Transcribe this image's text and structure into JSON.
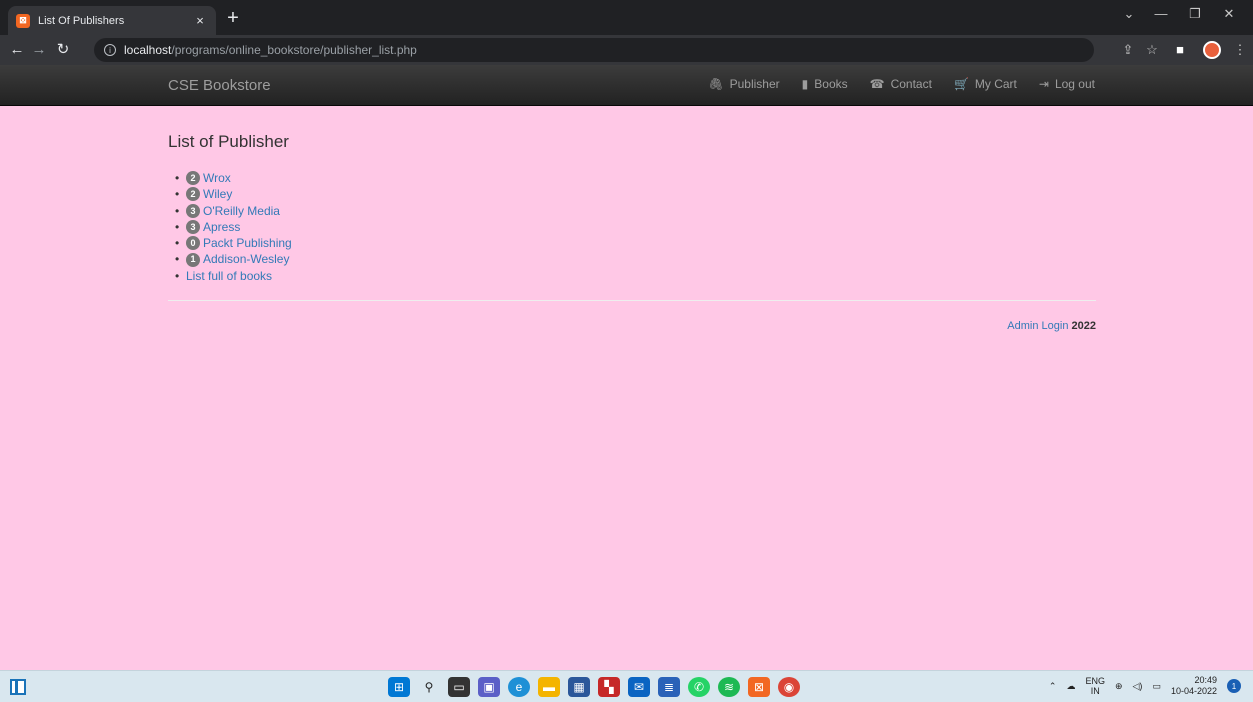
{
  "browser": {
    "tab_title": "List Of Publishers",
    "tab_close": "×",
    "new_tab": "+",
    "url_host": "localhost",
    "url_path": "/programs/online_bookstore/publisher_list.php",
    "window_controls": [
      "⌄",
      "—",
      "❐",
      "✕"
    ]
  },
  "navbar": {
    "brand": "CSE Bookstore",
    "links": [
      {
        "icon": "paperclip-icon",
        "glyph": "🖇",
        "label": "Publisher"
      },
      {
        "icon": "book-icon",
        "glyph": "▮",
        "label": "Books"
      },
      {
        "icon": "phone-icon",
        "glyph": "☎",
        "label": "Contact"
      },
      {
        "icon": "cart-icon",
        "glyph": "🛒",
        "label": "My Cart"
      },
      {
        "icon": "logout-icon",
        "glyph": "⇥",
        "label": "Log out"
      }
    ]
  },
  "main": {
    "title": "List of Publisher",
    "publishers": [
      {
        "count": "2",
        "name": "Wrox"
      },
      {
        "count": "2",
        "name": "Wiley"
      },
      {
        "count": "3",
        "name": "O'Reilly Media"
      },
      {
        "count": "3",
        "name": "Apress"
      },
      {
        "count": "0",
        "name": "Packt Publishing"
      },
      {
        "count": "1",
        "name": "Addison-Wesley"
      }
    ],
    "full_list_link": "List full of books"
  },
  "footer": {
    "admin_link": "Admin Login",
    "year": "2022"
  },
  "taskbar": {
    "lang_top": "ENG",
    "lang_bottom": "IN",
    "time": "20:49",
    "date": "10-04-2022",
    "notification_count": "1"
  },
  "colors": {
    "page_background": "#ffc8e6",
    "link": "#337ab7",
    "badge": "#777777",
    "navbar": "#222222"
  }
}
